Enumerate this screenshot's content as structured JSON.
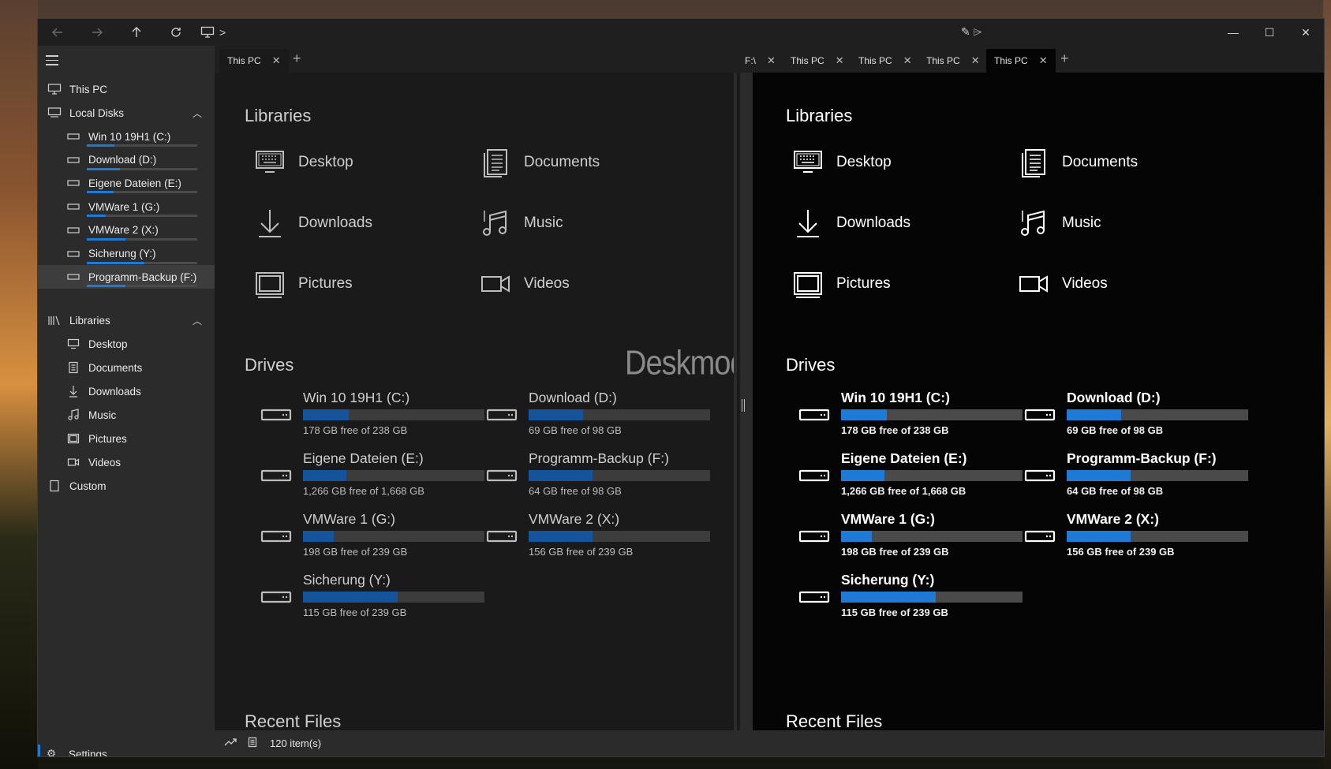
{
  "titlebar": {
    "nav": [
      "back-icon",
      "forward-icon",
      "up-icon",
      "refresh-icon"
    ],
    "breadcrumb_icon": "computer-icon",
    "breadcrumb_chevron": ">",
    "center_icons": "✎ ⌲"
  },
  "window_controls": {
    "minimize": "—",
    "maximize": "☐",
    "close": "✕"
  },
  "sidebar": {
    "this_pc": "This PC",
    "local_disks": "Local Disks",
    "drives": [
      {
        "label": "Win 10 19H1 (C:)",
        "used": 0.25
      },
      {
        "label": "Download (D:)",
        "used": 0.3
      },
      {
        "label": "Eigene Dateien (E:)",
        "used": 0.24
      },
      {
        "label": "VMWare 1 (G:)",
        "used": 0.17
      },
      {
        "label": "VMWare 2 (X:)",
        "used": 0.35
      },
      {
        "label": "Sicherung (Y:)",
        "used": 0.52
      },
      {
        "label": "Programm-Backup (F:)",
        "used": 0.35
      }
    ],
    "libraries": "Libraries",
    "library_items": [
      "Desktop",
      "Documents",
      "Downloads",
      "Music",
      "Pictures",
      "Videos"
    ],
    "custom": "Custom",
    "settings": "Settings"
  },
  "tabs_left": [
    {
      "label": "This PC",
      "close": "✕"
    }
  ],
  "tabs_right": [
    {
      "label": "F:\\",
      "close": "✕"
    },
    {
      "label": "This PC",
      "close": "✕"
    },
    {
      "label": "This PC",
      "close": "✕"
    },
    {
      "label": "This PC",
      "close": "✕"
    },
    {
      "label": "This PC",
      "close": "✕"
    }
  ],
  "tab_add": "+",
  "pane": {
    "libraries_title": "Libraries",
    "libraries": [
      "Desktop",
      "Documents",
      "Downloads",
      "Music",
      "Pictures",
      "Videos"
    ],
    "drives_title": "Drives",
    "drives": [
      {
        "name": "Win 10 19H1 (C:)",
        "free": "178 GB free of 238 GB",
        "used": 0.25
      },
      {
        "name": "Download (D:)",
        "free": "69 GB free of 98 GB",
        "used": 0.3
      },
      {
        "name": "Eigene Dateien (E:)",
        "free": "1,266 GB free of 1,668 GB",
        "used": 0.24
      },
      {
        "name": "Programm-Backup (F:)",
        "free": "64 GB free of 98 GB",
        "used": 0.35
      },
      {
        "name": "VMWare 1 (G:)",
        "free": "198 GB free of 239 GB",
        "used": 0.17
      },
      {
        "name": "VMWare 2 (X:)",
        "free": "156 GB free of 239 GB",
        "used": 0.35
      },
      {
        "name": "Sicherung (Y:)",
        "free": "115 GB free of 239 GB",
        "used": 0.52
      }
    ],
    "recent_title": "Recent Files"
  },
  "watermark": "Deskmodder.de",
  "statusbar": {
    "items": "120 item(s)"
  },
  "colors": {
    "accent": "#1e7ad4",
    "accent_dim": "#15539a"
  }
}
